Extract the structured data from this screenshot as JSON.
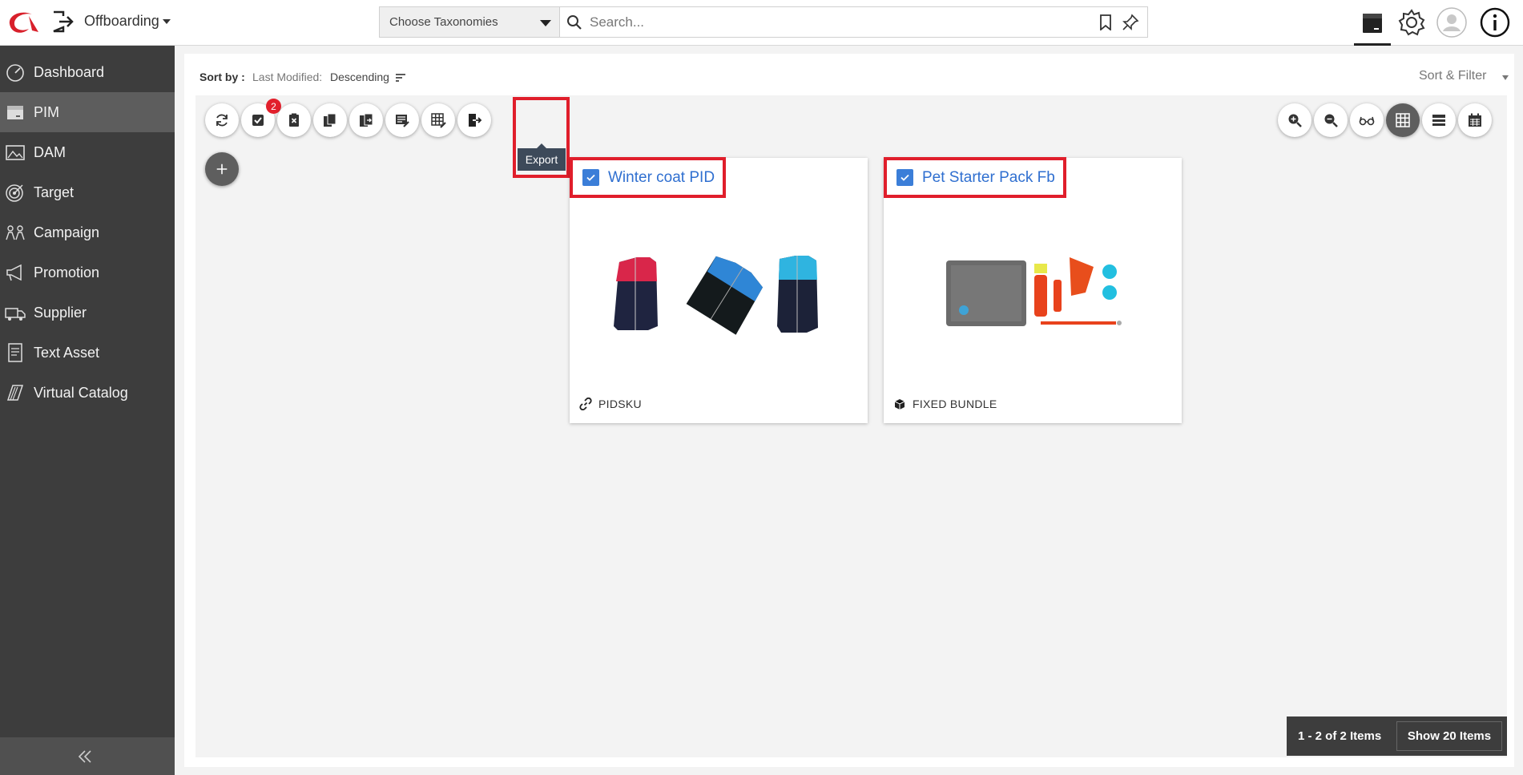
{
  "header": {
    "module_title": "Offboarding",
    "taxonomy_placeholder": "Choose Taxonomies",
    "search_placeholder": "Search..."
  },
  "sidebar": {
    "items": [
      {
        "label": "Dashboard",
        "icon": "dashboard-icon"
      },
      {
        "label": "PIM",
        "icon": "pim-icon",
        "active": true
      },
      {
        "label": "DAM",
        "icon": "dam-icon"
      },
      {
        "label": "Target",
        "icon": "target-icon"
      },
      {
        "label": "Campaign",
        "icon": "campaign-icon"
      },
      {
        "label": "Promotion",
        "icon": "promotion-icon"
      },
      {
        "label": "Supplier",
        "icon": "supplier-icon"
      },
      {
        "label": "Text Asset",
        "icon": "text-asset-icon"
      },
      {
        "label": "Virtual Catalog",
        "icon": "virtual-catalog-icon"
      }
    ]
  },
  "sortbar": {
    "label": "Sort by :",
    "field": "Last Modified:",
    "direction": "Descending",
    "sort_filter_label": "Sort & Filter"
  },
  "toolbar": {
    "selected_badge": "2",
    "export_tooltip": "Export"
  },
  "cards": [
    {
      "title": "Winter coat PID",
      "type": "PIDSKU",
      "checked": true
    },
    {
      "title": "Pet Starter Pack Fb",
      "type": "FIXED BUNDLE",
      "checked": true
    }
  ],
  "pager": {
    "count": "1 - 2 of 2 Items",
    "show_label": "Show 20 Items"
  },
  "colors": {
    "accent_red": "#e01e2b",
    "link_blue": "#2f6fd0",
    "sidebar_bg": "#3d3d3d"
  }
}
